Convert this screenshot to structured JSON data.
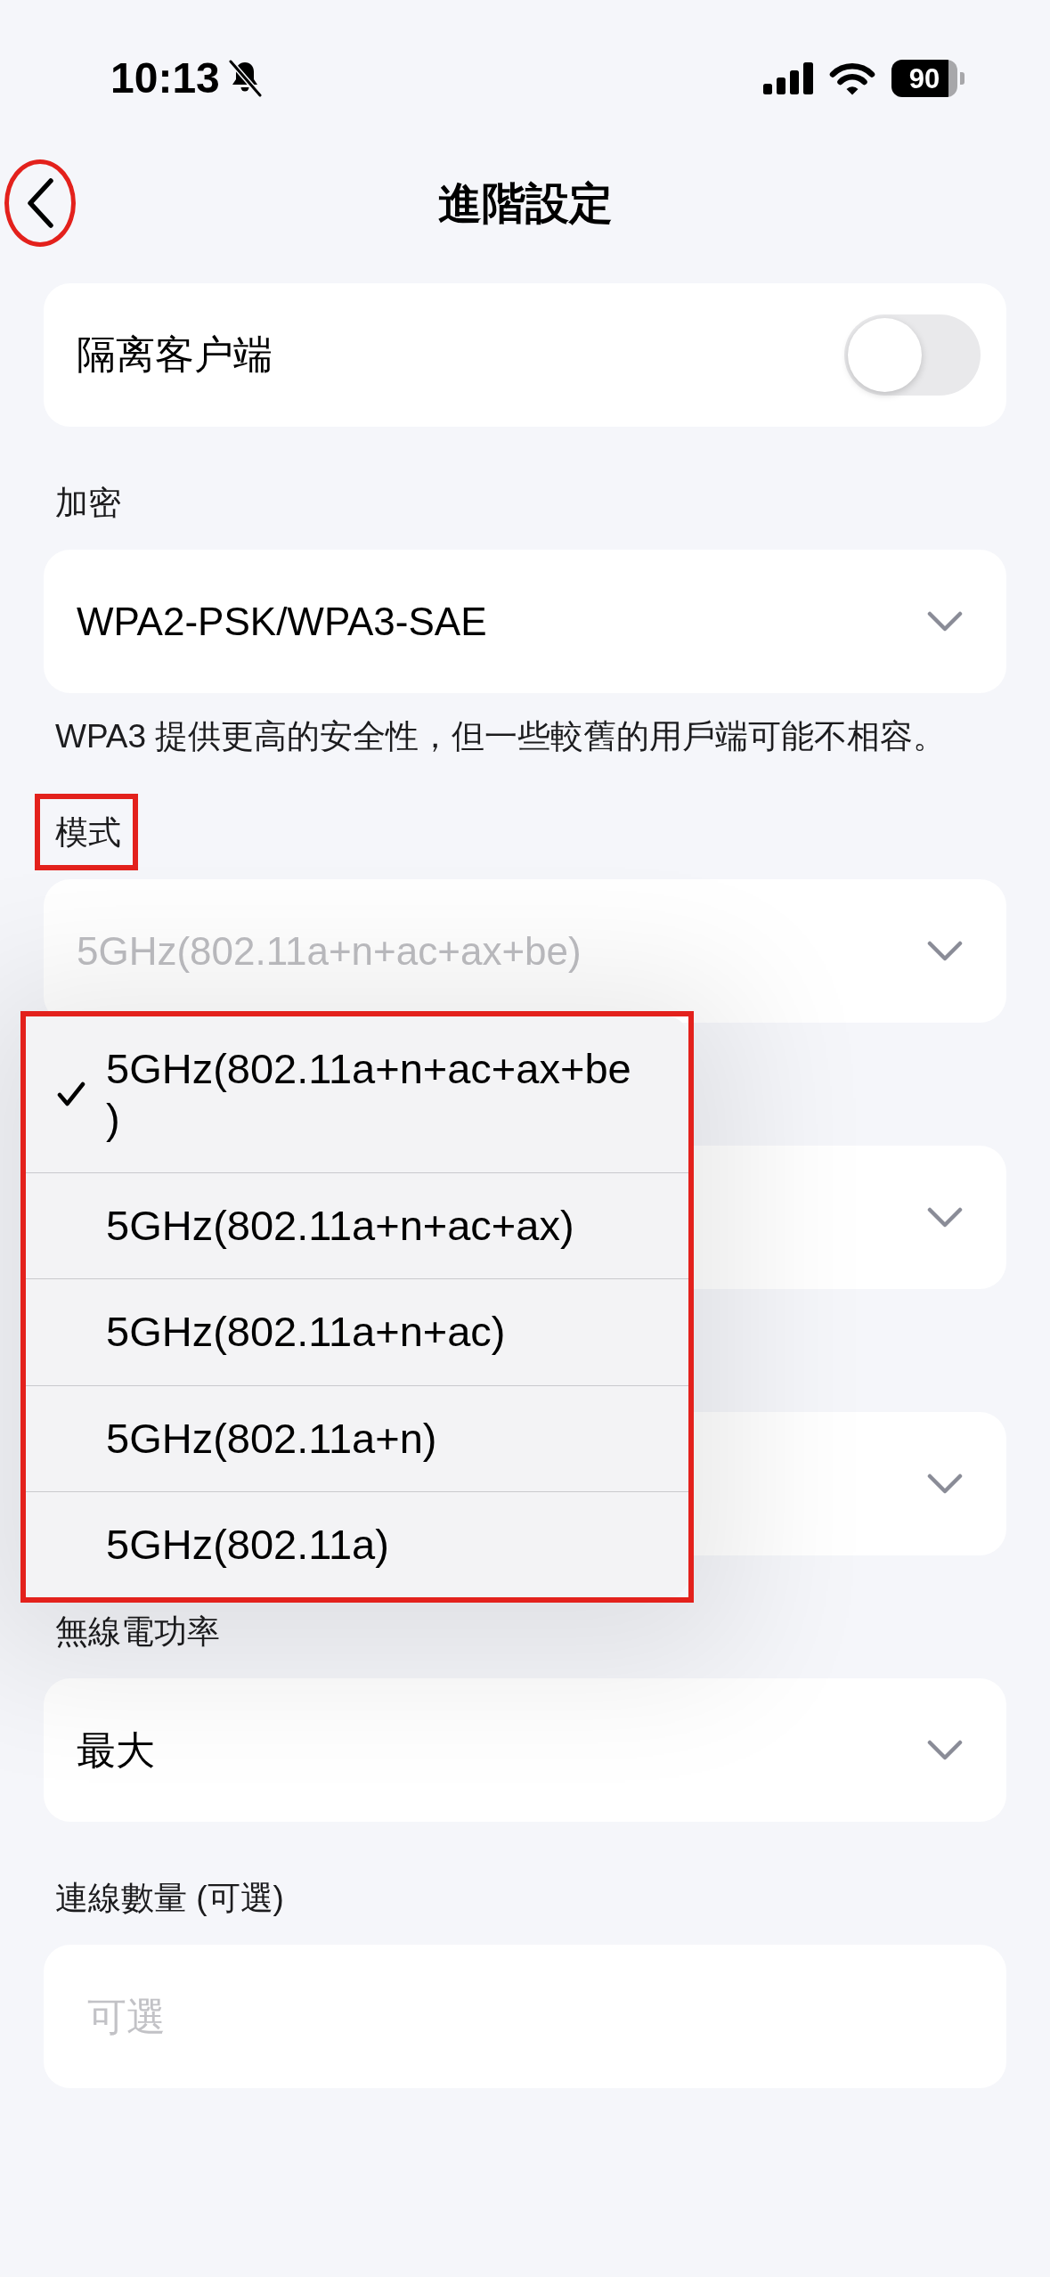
{
  "status_bar": {
    "time": "10:13",
    "silent": true,
    "battery": "90"
  },
  "header": {
    "title": "進階設定",
    "back_highlighted": true
  },
  "toggle_row": {
    "label": "隔离客户端",
    "on": false
  },
  "sections": [
    {
      "kind": "select",
      "label": "加密",
      "label_highlighted": false,
      "value": "WPA2-PSK/WPA3-SAE",
      "expanded": false,
      "hint": "WPA3 提供更高的安全性，但一些較舊的用戶端可能不相容。"
    },
    {
      "kind": "select",
      "label": "模式",
      "label_highlighted": true,
      "value": "5GHz(802.11a+n+ac+ax+be)",
      "expanded": true,
      "menu": {
        "highlighted": true,
        "options": [
          {
            "label": "5GHz(802.11a+n+ac+ax+be)",
            "selected": true
          },
          {
            "label": "5GHz(802.11a+n+ac+ax)",
            "selected": false
          },
          {
            "label": "5GHz(802.11a+n+ac)",
            "selected": false
          },
          {
            "label": "5GHz(802.11a+n)",
            "selected": false
          },
          {
            "label": "5GHz(802.11a)",
            "selected": false
          }
        ]
      }
    },
    {
      "kind": "select"
    },
    {
      "kind": "select"
    },
    {
      "kind": "select",
      "label": "無線電功率",
      "label_highlighted": false,
      "value": "最大",
      "expanded": false
    },
    {
      "kind": "input",
      "label": "連線數量 (可選)",
      "label_highlighted": false,
      "placeholder": "可選"
    }
  ]
}
